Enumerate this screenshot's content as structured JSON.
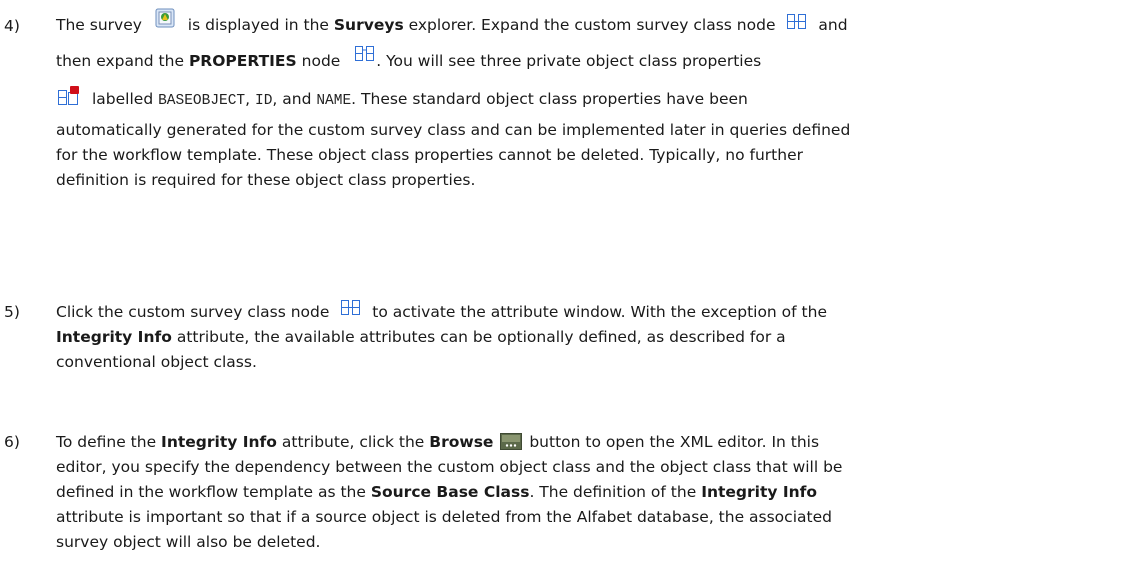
{
  "items": [
    {
      "number": "4)",
      "segments": {
        "s1": "The survey",
        "s2": "is displayed in the",
        "s3": "Surveys",
        "s4": "explorer. Expand the custom survey class node",
        "s5": "and",
        "s6": "then expand the",
        "s7": "PROPERTIES",
        "s8": "node",
        "s9": ". You will see three private object class properties",
        "s10": "labelled",
        "s11": "BASEOBJECT",
        "s12": ",",
        "s13": "ID",
        "s14": ", and",
        "s15": "NAME",
        "s16": ". These standard object class properties have been",
        "l5": "automatically generated for the custom survey class and can be implemented later in queries defined",
        "l6": "for the workflow template. These object class properties cannot be deleted. Typically, no further",
        "l7": "definition is required for these object class properties."
      }
    },
    {
      "number": "5)",
      "segments": {
        "s1": "Click the custom survey class node",
        "s2": "to activate the attribute window. With the exception of the",
        "s3": "Integrity Info",
        "s4": "attribute, the available attributes can be optionally defined, as described for a",
        "l3": "conventional object class."
      }
    },
    {
      "number": "6)",
      "segments": {
        "s1": "To define the",
        "s2": "Integrity Info",
        "s3": "attribute, click the",
        "s4": "Browse",
        "s5": "button to open the XML editor. In this",
        "l2": "editor, you specify the dependency between the custom object class and the object class that will be",
        "l3a": "defined in the workflow template as the",
        "l3b": "Source Base Class",
        "l3c": ". The definition of the",
        "l3d": "Integrity Info",
        "l4": "attribute is important so that if a source object is deleted from the Alfabet database, the associated",
        "l5": "survey object will also be deleted."
      }
    }
  ],
  "icons": {
    "survey": "survey-document-icon",
    "class_node": "class-node-icon",
    "properties_node": "properties-node-icon",
    "private_property": "private-property-icon",
    "browse": "browse-button-icon"
  },
  "colors": {
    "text": "#1a1a1a",
    "icon_blue": "#2f6fd6",
    "private_red": "#d0101a"
  }
}
